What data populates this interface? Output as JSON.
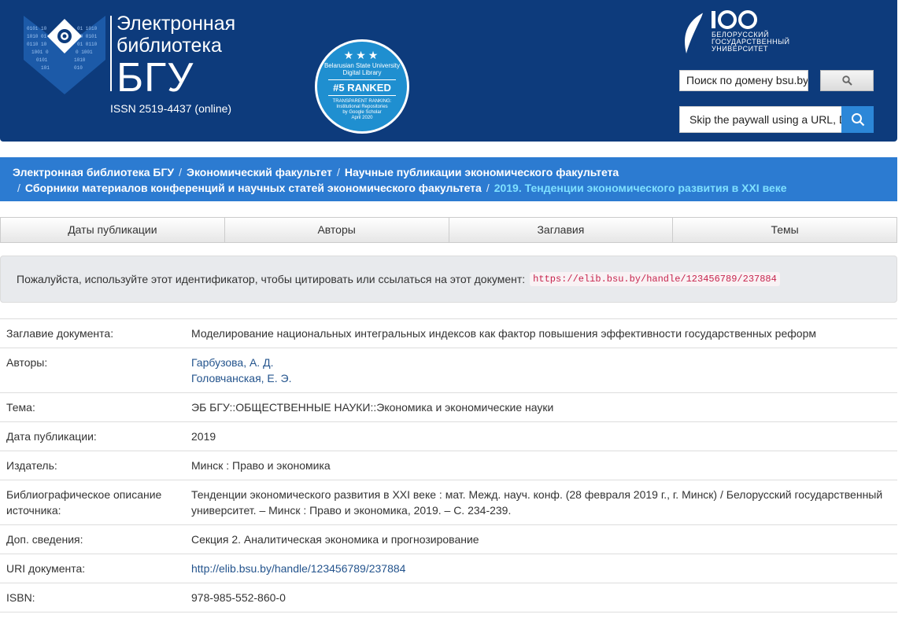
{
  "header": {
    "logo_line1": "Электронная",
    "logo_line2": "библиотека",
    "logo_line3": "БГУ",
    "issn": "ISSN 2519-4437 (online)",
    "rank_badge": {
      "stars": "★★★",
      "institution": "Belarusian State University Digital Library",
      "rank": "#5 RANKED",
      "line1": "TRANSPARENT RANKING:",
      "line2": "Institutional Repositories",
      "line3": "by Google Scholar",
      "date": "April 2020"
    },
    "university": {
      "line1": "БЕЛОРУССКИЙ",
      "line2": "ГОСУДАРСТВЕННЫЙ",
      "line3": "УНИВЕРСИТЕТ"
    },
    "search_placeholder": "Поиск по домену bsu.by",
    "paywall_placeholder": "Skip the paywall using a URL, DOI"
  },
  "breadcrumb": {
    "items": [
      "Электронная библиотека БГУ",
      "Экономический факультет",
      "Научные публикации экономического факультета",
      "Сборники материалов конференций и научных статей экономического факультета"
    ],
    "current": "2019. Тенденции экономического развития в XXI веке",
    "separator": "/"
  },
  "browse": [
    "Даты публикации",
    "Авторы",
    "Заглавия",
    "Темы"
  ],
  "citation": {
    "text": "Пожалуйста, используйте этот идентификатор, чтобы цитировать или ссылаться на этот документ:",
    "uri": "https://elib.bsu.by/handle/123456789/237884"
  },
  "metadata": {
    "title_label": "Заглавие документа:",
    "title": "Моделирование национальных интегральных индексов как фактор повышения эффективности государственных реформ",
    "authors_label": "Авторы:",
    "authors": [
      "Гарбузова, А. Д.",
      "Головчанская, Е. Э."
    ],
    "subject_label": "Тема:",
    "subject": "ЭБ БГУ::ОБЩЕСТВЕННЫЕ НАУКИ::Экономика и экономические науки",
    "date_label": "Дата публикации:",
    "date": "2019",
    "publisher_label": "Издатель:",
    "publisher": "Минск : Право и экономика",
    "citation_label": "Библиографическое описание источника:",
    "citation": "Тенденции экономического развития в XXI веке : мат. Межд. науч. конф. (28 февраля 2019 г., г. Минск) / Белорусский государственный университет. – Минск : Право и экономика, 2019. – С. 234-239.",
    "notes_label": "Доп. сведения:",
    "notes": "Секция 2. Аналитическая экономика и прогнозирование",
    "uri_label": "URI документа:",
    "uri": "http://elib.bsu.by/handle/123456789/237884",
    "isbn_label": "ISBN:",
    "isbn": "978-985-552-860-0"
  },
  "colors": {
    "header_bg": "#0d3b7c",
    "breadcrumb_bg": "#2c7bd1",
    "breadcrumb_current": "#7ee0ff",
    "link": "#24548d"
  }
}
